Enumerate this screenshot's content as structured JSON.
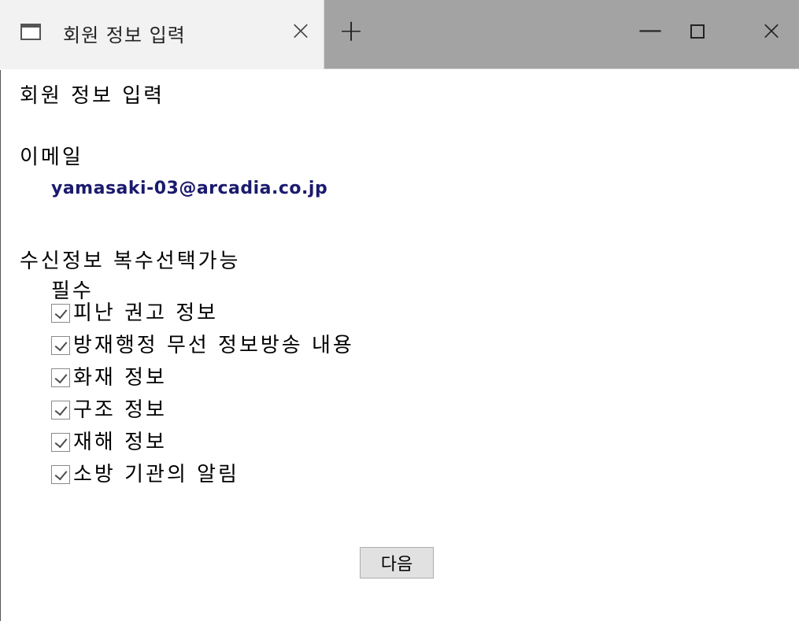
{
  "tab": {
    "title": "회원 정보 입력",
    "close_glyph": "×",
    "icon": "window-icon"
  },
  "newtab": {
    "glyph": "+"
  },
  "window_controls": {
    "minimize_glyph": "—",
    "close_glyph": "×"
  },
  "page": {
    "title": "회원 정보 입력",
    "email_label": "이메일",
    "email_value": "yamasaki-03@arcadia.co.jp",
    "receive_label": "수신정보 복수선택가능",
    "required_label": "필수",
    "options": [
      {
        "label": "피난 권고 정보",
        "checked": true
      },
      {
        "label": "방재행정 무선 정보방송 내용",
        "checked": true
      },
      {
        "label": "화재 정보",
        "checked": true
      },
      {
        "label": "구조 정보",
        "checked": true
      },
      {
        "label": "재해 정보",
        "checked": true
      },
      {
        "label": "소방 기관의 알림",
        "checked": true
      }
    ],
    "next_button": "다음"
  },
  "colors": {
    "titlebar": "#a3a3a3",
    "active_tab": "#f2f2f2",
    "email_text": "#1a1a6e"
  }
}
